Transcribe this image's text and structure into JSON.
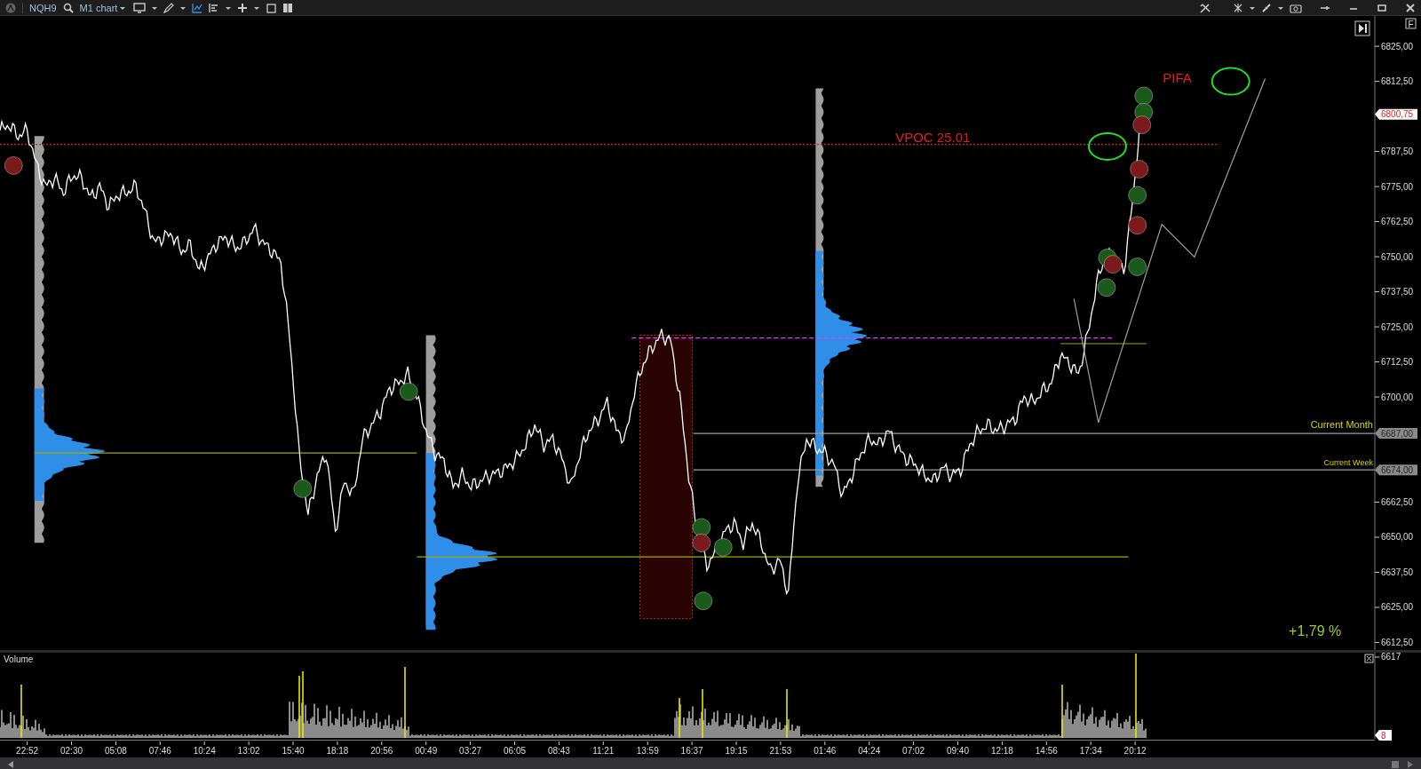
{
  "toolbar": {
    "symbol": "NQH9",
    "chart_menu": "M1 chart"
  },
  "chart": {
    "axis_button": "F",
    "price_axis": [
      "6825,00",
      "6812,50",
      "6787,50",
      "6775,00",
      "6762,50",
      "6750,00",
      "6737,50",
      "6725,00",
      "6712,50",
      "6700,00",
      "6662,50",
      "6650,00",
      "6637,50",
      "6625,00",
      "6612,50"
    ],
    "last_price_tag": "6800,75",
    "level_tags": [
      "6687,00",
      "6674,00"
    ],
    "vpoc_label": "VPOC 25.01",
    "pifa_label": "PIFA",
    "month_label": "Current Month",
    "week_label": "Current Week",
    "change_label": "+1,79 %",
    "signals": [
      {
        "color": "#7a1a1a"
      },
      {
        "color": "#1c5a1c"
      },
      {
        "color": "#1c5a1c"
      },
      {
        "color": "#1c5a1c"
      },
      {
        "color": "#7a1a1a"
      },
      {
        "color": "#1c5a1c"
      },
      {
        "color": "#1c5a1c"
      },
      {
        "color": "#1c5a1c"
      },
      {
        "color": "#1c5a1c"
      },
      {
        "color": "#7a1a1a"
      },
      {
        "color": "#7a1a1a"
      },
      {
        "color": "#1c5a1c"
      },
      {
        "color": "#7a1a1a"
      },
      {
        "color": "#1c5a1c"
      },
      {
        "color": "#7a1a1a"
      },
      {
        "color": "#1c5a1c"
      },
      {
        "color": "#1c5a1c"
      }
    ]
  },
  "volume": {
    "title": "Volume",
    "scale_label": "6617",
    "count_tag": "8"
  },
  "time_axis": [
    "22:52",
    "02:30",
    "05:08",
    "07:46",
    "10:24",
    "13:02",
    "15:40",
    "18:18",
    "20:56",
    "00:49",
    "03:27",
    "06:05",
    "08:43",
    "11:21",
    "13:59",
    "16:37",
    "19:15",
    "21:53",
    "01:46",
    "04:24",
    "07:02",
    "09:40",
    "12:18",
    "14:56",
    "17:34",
    "20:12"
  ]
}
